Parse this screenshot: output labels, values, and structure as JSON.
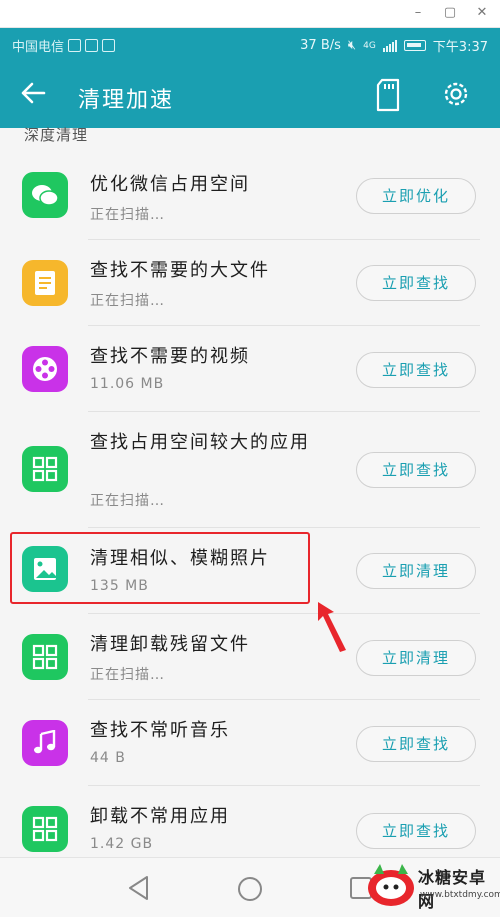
{
  "status_bar": {
    "carrier": "中国电信",
    "speed": "37 B/s",
    "network": "4G",
    "time": "下午3:37"
  },
  "toolbar": {
    "title": "清理加速"
  },
  "section_label": "深度清理",
  "items": [
    {
      "title": "优化微信占用空间",
      "subtitle": "正在扫描…",
      "button": "立即优化",
      "icon": "wechat-icon",
      "color": "#1fc760"
    },
    {
      "title": "查找不需要的大文件",
      "subtitle": "正在扫描…",
      "button": "立即查找",
      "icon": "document-icon",
      "color": "#f6b72c"
    },
    {
      "title": "查找不需要的视频",
      "subtitle": "11.06 MB",
      "button": "立即查找",
      "icon": "film-reel-icon",
      "color": "#c932e8"
    },
    {
      "title": "查找占用空间较大的应用",
      "subtitle": "正在扫描…",
      "button": "立即查找",
      "icon": "apps-grid-icon",
      "color": "#1fc760"
    },
    {
      "title": "清理相似、模糊照片",
      "subtitle": "135 MB",
      "button": "立即清理",
      "icon": "photo-icon",
      "color": "#1bc48f"
    },
    {
      "title": "清理卸载残留文件",
      "subtitle": "正在扫描…",
      "button": "立即清理",
      "icon": "apps-grid-icon",
      "color": "#1fc760"
    },
    {
      "title": "查找不常听音乐",
      "subtitle": "44 B",
      "button": "立即查找",
      "icon": "music-note-icon",
      "color": "#c932e8"
    },
    {
      "title": "卸载不常用应用",
      "subtitle": "1.42 GB",
      "button": "立即查找",
      "icon": "apps-grid-icon",
      "color": "#1fc760"
    }
  ],
  "watermark": {
    "title": "冰糖安卓网",
    "url": "www.btxtdmy.com"
  }
}
